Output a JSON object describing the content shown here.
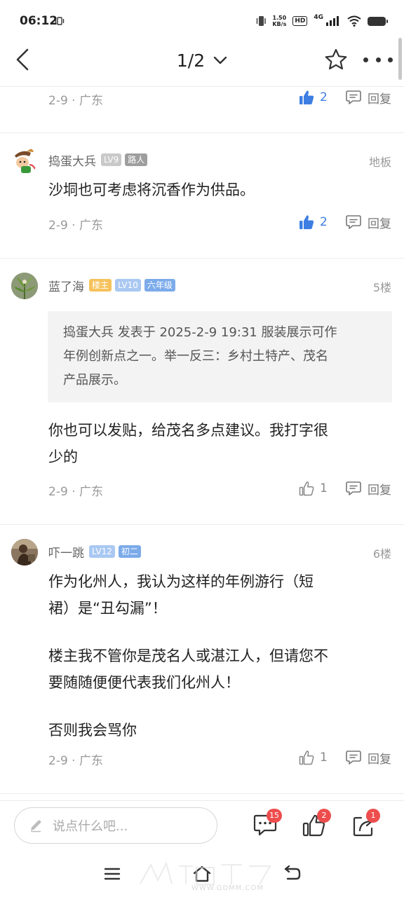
{
  "status_bar": {
    "time": "06:12",
    "net_speed_value": "1.50",
    "net_speed_unit": "KB/s",
    "hd_label": "HD",
    "network_type": "4G"
  },
  "header": {
    "page_indicator": "1/2"
  },
  "posts": [
    {
      "date_location": "2-9 · 广东",
      "like_count": "2",
      "liked": true,
      "reply_label": "回复"
    },
    {
      "username": "捣蛋大兵",
      "level": "LV9",
      "tag": "路人",
      "floor": "地板",
      "text": "沙垌也可考虑将沉香作为供品。",
      "date_location": "2-9 · 广东",
      "like_count": "2",
      "liked": true,
      "reply_label": "回复"
    },
    {
      "username": "蓝了海",
      "owner_badge": "楼主",
      "level": "LV10",
      "tag": "六年级",
      "floor": "5楼",
      "quote": {
        "line1": "捣蛋大兵 发表于 2025-2-9 19:31 服装展示可作",
        "line2": "年例创新点之一。举一反三：乡村土特产、茂名",
        "line3": "产品展示。"
      },
      "text_line1": "你也可以发贴，给茂名多点建议。我打字很",
      "text_line2": "少的",
      "date_location": "2-9 · 广东",
      "like_count": "1",
      "liked": false,
      "reply_label": "回复"
    },
    {
      "username": "吓一跳",
      "level": "LV12",
      "tag": "初二",
      "floor": "6楼",
      "para1_line1": "作为化州人，我认为这样的年例游行（短",
      "para1_line2": "裙）是“丑勾漏”！",
      "para2_line1": "楼主我不管你是茂名人或湛江人，但请您不",
      "para2_line2": "要随随便便代表我们化州人！",
      "para3_line1": "否则我会骂你",
      "date_location": "2-9 · 广东",
      "like_count": "1",
      "liked": false,
      "reply_label": "回复"
    }
  ],
  "bottom_bar": {
    "comment_placeholder": "说点什么吧...",
    "comment_count": "15",
    "like_count": "2",
    "share_count": "1"
  },
  "watermark": {
    "text": "WWW.GDMM.COM"
  },
  "colors": {
    "accent_blue": "#3d7ee3",
    "badge_red": "#ee4d4d",
    "owner_badge": "#f5c25b"
  },
  "icons": {
    "back": "back-arrow-icon",
    "dropdown": "chevron-down-icon",
    "favorite": "star-icon",
    "more": "more-icon",
    "like": "thumbs-up-icon",
    "reply": "comment-icon",
    "edit": "pencil-icon",
    "share": "share-icon"
  }
}
